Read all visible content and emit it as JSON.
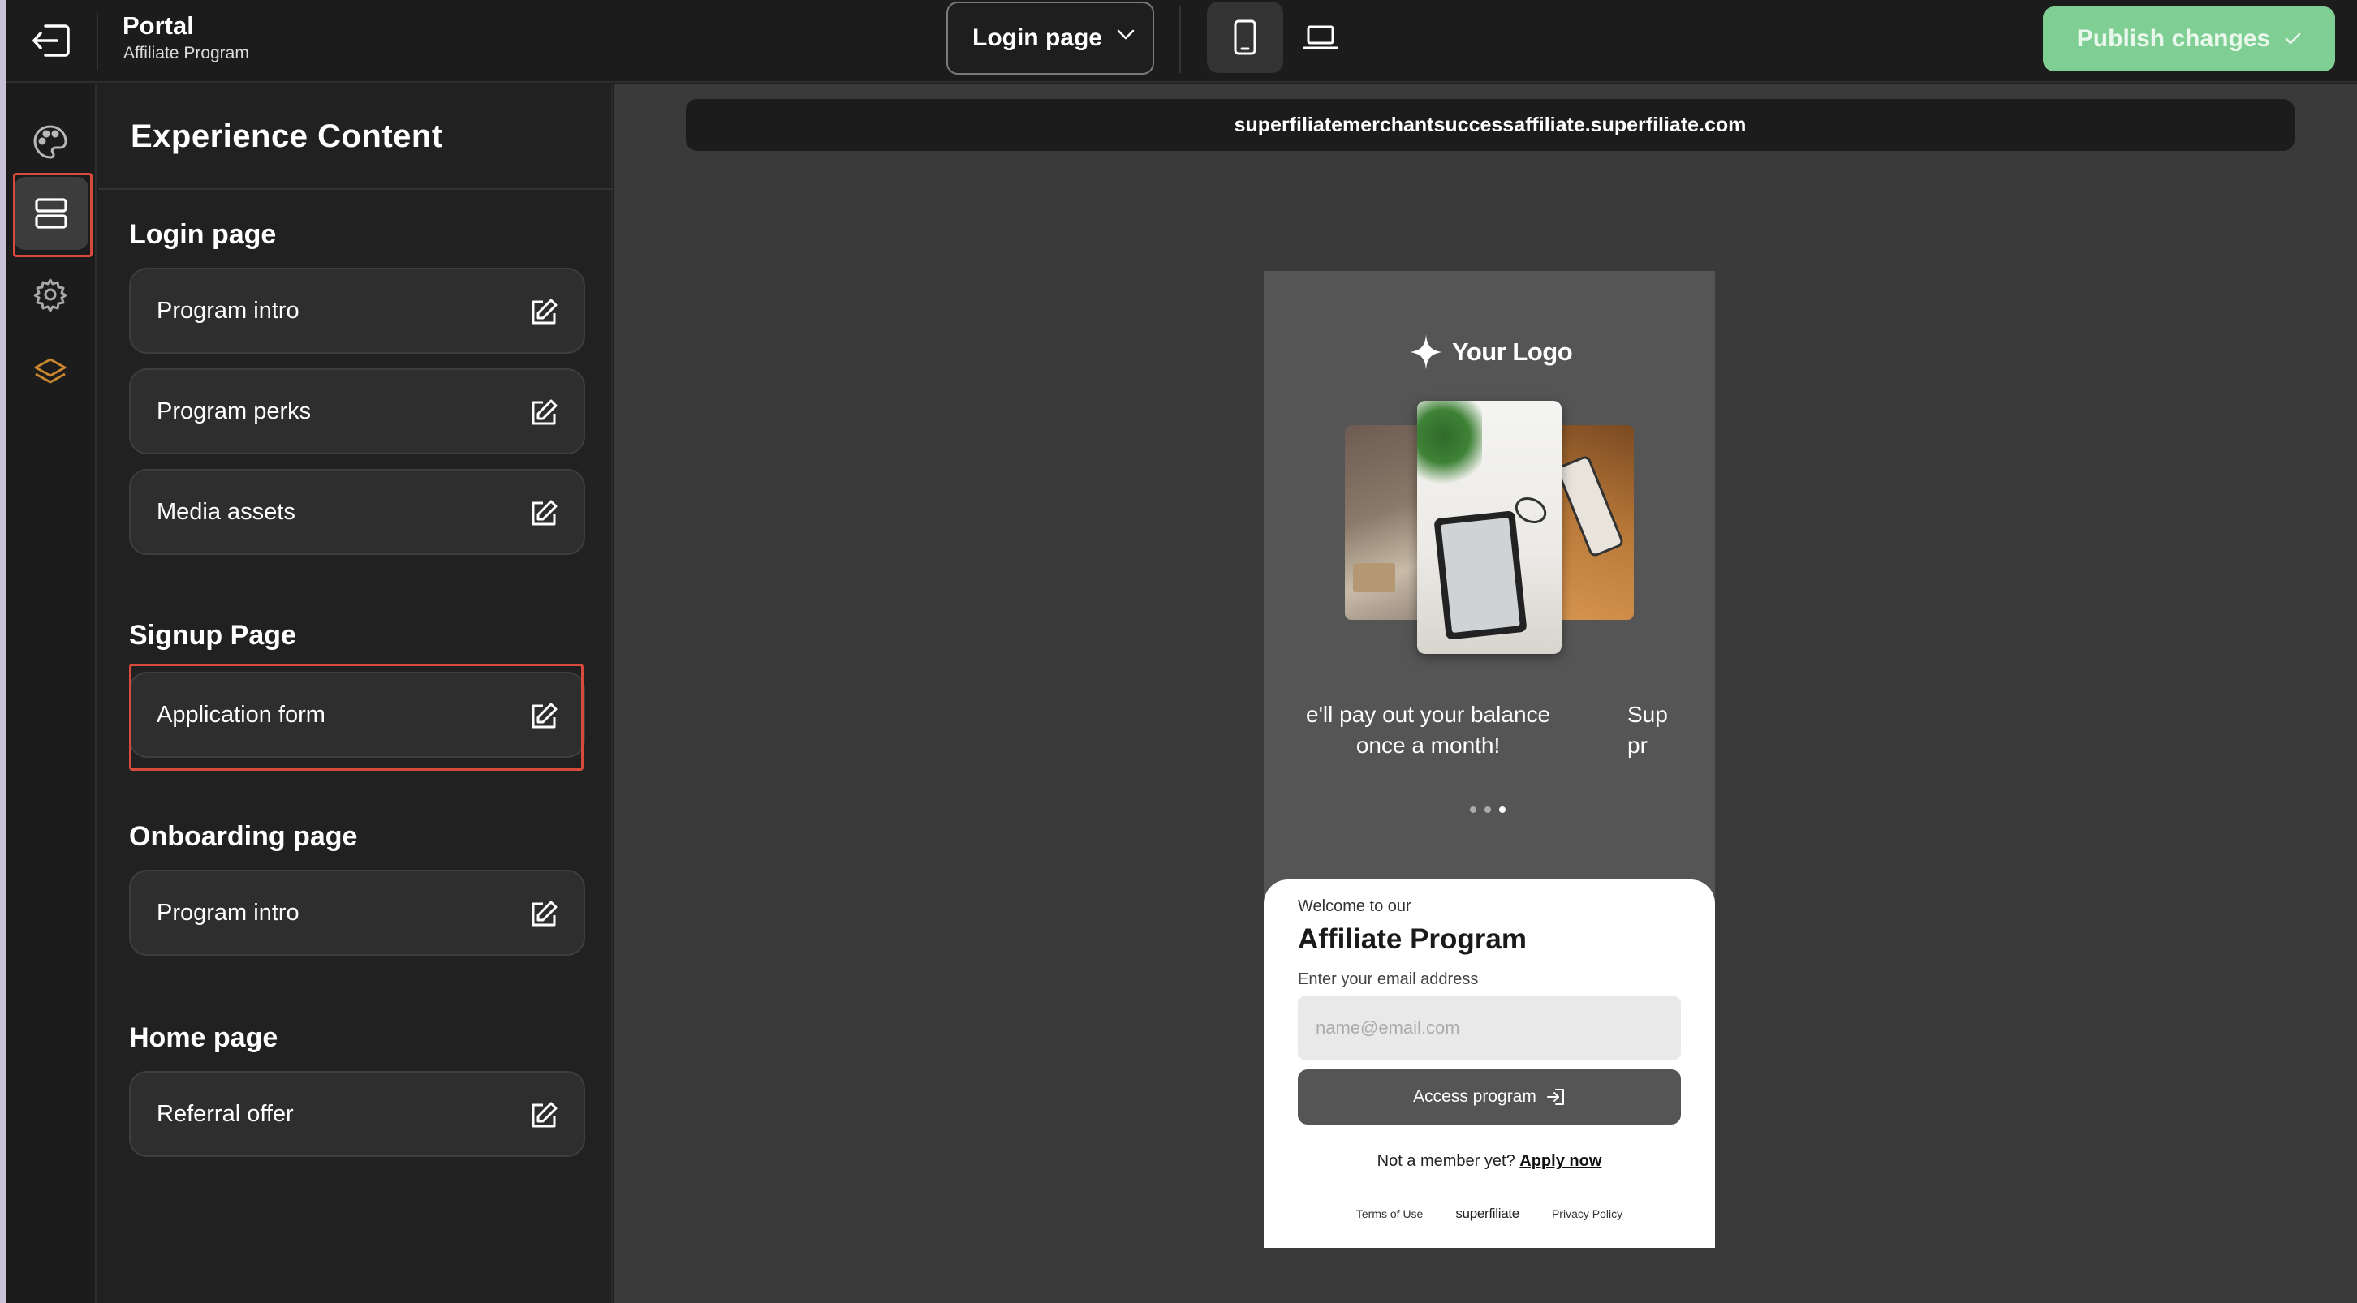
{
  "header": {
    "title": "Portal",
    "subtitle": "Affiliate Program",
    "page_select": "Login page",
    "publish_label": "Publish changes"
  },
  "panel": {
    "title": "Experience Content",
    "sections": [
      {
        "title": "Login page",
        "items": [
          "Program intro",
          "Program perks",
          "Media assets"
        ]
      },
      {
        "title": "Signup Page",
        "items": [
          "Application form"
        ]
      },
      {
        "title": "Onboarding page",
        "items": [
          "Program intro"
        ]
      },
      {
        "title": "Home page",
        "items": [
          "Referral offer"
        ]
      }
    ]
  },
  "preview": {
    "url": "superfiliatemerchantsuccessaffiliate.superfiliate.com",
    "logo_text": "Your Logo",
    "slide_text_main": "e'll pay out your balance\nonce a month!",
    "slide_text_next": "Sup\npr",
    "login": {
      "welcome": "Welcome to our",
      "title": "Affiliate Program",
      "email_label": "Enter your email address",
      "email_placeholder": "name@email.com",
      "access_label": "Access program",
      "member_text": "Not a member yet?",
      "apply_label": "Apply now",
      "terms": "Terms of Use",
      "brand": "superfiliate",
      "privacy": "Privacy Policy"
    }
  },
  "colors": {
    "accent_green": "#7fcf94",
    "highlight_red": "#d84a3c",
    "rail_icon_orange": "#c8862e"
  },
  "icons": {
    "exit": "exit-icon",
    "palette": "palette-icon",
    "layout": "layout-icon",
    "settings": "gear-icon",
    "layers": "layers-icon",
    "edit": "edit-icon",
    "mobile": "mobile-icon",
    "desktop": "laptop-icon"
  }
}
